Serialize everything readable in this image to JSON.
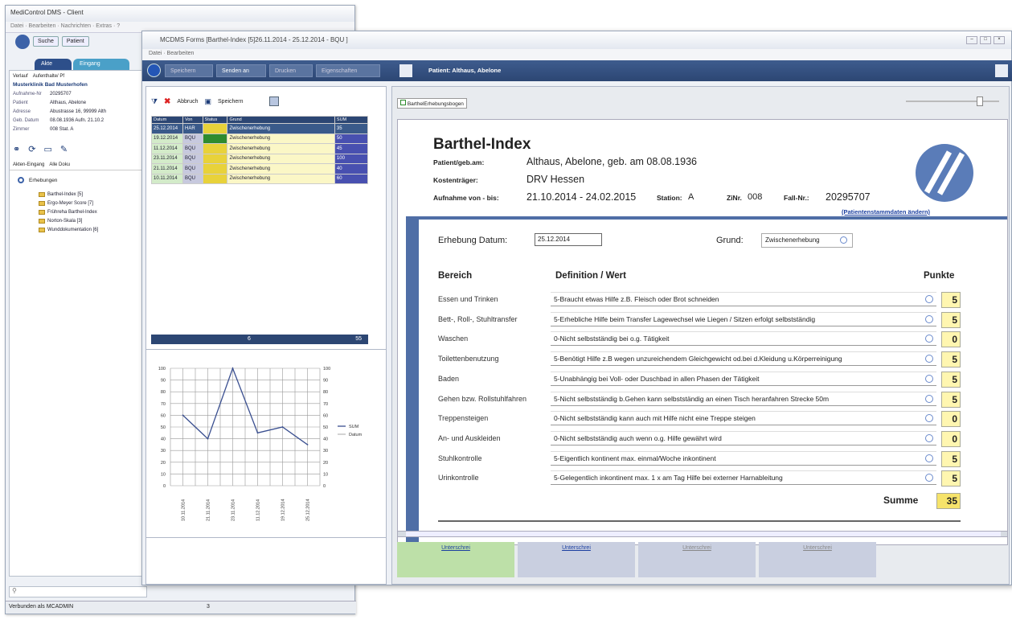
{
  "back_window": {
    "title": "MediControl DMS - Client",
    "menu": "Datei · Bearbeiten · Nachrichten · Extras · ?",
    "btn_search": "Suche",
    "btn_patient": "Patient",
    "tab_active": "Akte",
    "tab_inbox": "Eingang",
    "nav_history": "Verlauf",
    "nav_stays": "Aufenthalte/ Pf",
    "clinic": "Musterklinik Bad Musterhofen",
    "fields": [
      {
        "label": "Aufnahme-Nr",
        "value": "20295707"
      },
      {
        "label": "Patient",
        "value": "Althaus, Abelone"
      },
      {
        "label": "Adresse",
        "value": "Abustrasse 16, 99999 Alth"
      },
      {
        "label": "Geb. Datum",
        "value": "08.08.1936   Aufn. 21.10.2"
      },
      {
        "label": "Zimmer",
        "value": "008   Stat. A"
      }
    ],
    "doc_tab1": "Akten-Eingang",
    "doc_tab2": "Alle Doku",
    "tree_root": "Erhebungen",
    "tree_items": [
      "Barthel-Index [5]",
      "Ergo-Meyer Score [7]",
      "Frühreha Barthel-Index",
      "Norton-Skala [3]",
      "Wunddokumentation [6]"
    ],
    "status_left": "Verbunden als MCADMIN",
    "status_right": "3"
  },
  "front_window": {
    "title": "MCDMS Forms [Barthel-Index [5]26.11.2014 - 25.12.2014 - BQU ]",
    "menu": "Datei · Bearbeiten",
    "toolbar": {
      "save": "Speichern",
      "send": "Senden an",
      "print": "Drucken",
      "props": "Eigenschaften",
      "patient": "Patient: Althaus, Abelone"
    },
    "list_toolbar": {
      "abort": "Abbruch",
      "save": "Speichern"
    },
    "list_headers": [
      "Datum",
      "Von",
      "Status",
      "Grund",
      "SUM"
    ],
    "list_rows": [
      {
        "date": "25.12.2014",
        "by": "HAR",
        "reason": "Zwischenerhebung",
        "sum": "35"
      },
      {
        "date": "19.12.2014",
        "by": "BQU",
        "reason": "Zwischenerhebung",
        "sum": "50"
      },
      {
        "date": "11.12.2014",
        "by": "BQU",
        "reason": "Zwischenerhebung",
        "sum": "45"
      },
      {
        "date": "23.11.2014",
        "by": "BQU",
        "reason": "Zwischenerhebung",
        "sum": "100"
      },
      {
        "date": "21.11.2014",
        "by": "BQU",
        "reason": "Zwischenerhebung",
        "sum": "40"
      },
      {
        "date": "10.11.2014",
        "by": "BQU",
        "reason": "Zwischenerhebung",
        "sum": "60"
      }
    ],
    "list_footer": {
      "count": "6",
      "sum": "55"
    },
    "form_tab": "BarthelErhebungsbogen",
    "form": {
      "title": "Barthel-Index",
      "patient_label": "Patient/geb.am:",
      "patient_value": "Althaus, Abelone, geb. am 08.08.1936",
      "payer_label": "Kostenträger:",
      "payer_value": "DRV Hessen",
      "stay_label": "Aufnahme von - bis:",
      "stay_value": "21.10.2014 - 24.02.2015",
      "station_label": "Station:",
      "station_value": "A",
      "room_label": "ZiNr.",
      "room_value": "008",
      "case_label": "Fall-Nr.:",
      "case_value": "20295707",
      "edit_link": "(Patientenstammdaten ändern)",
      "date_label": "Erhebung Datum:",
      "date_value": "25.12.2014",
      "reason_label": "Grund:",
      "reason_value": "Zwischenerhebung",
      "col_area": "Bereich",
      "col_def": "Definition / Wert",
      "col_points": "Punkte",
      "sum_label": "Summe",
      "sum_value": "35",
      "items": [
        {
          "area": "Essen und Trinken",
          "def": "5-Braucht etwas Hilfe z.B. Fleisch oder Brot schneiden",
          "pts": "5"
        },
        {
          "area": "Bett-, Roll-, Stuhltransfer",
          "def": "5-Erhebliche Hilfe beim Transfer  Lagewechsel wie Liegen / Sitzen erfolgt selbstständig",
          "pts": "5"
        },
        {
          "area": "Waschen",
          "def": "0-Nicht selbstständig bei o.g. Tätigkeit",
          "pts": "0"
        },
        {
          "area": "Toilettenbenutzung",
          "def": "5-Benötigt Hilfe z.B wegen unzureichendem Gleichgewicht od.bei d.Kleidung u.Körperreinigung",
          "pts": "5"
        },
        {
          "area": "Baden",
          "def": "5-Unabhängig bei Voll- oder Duschbad in allen Phasen der Tätigkeit",
          "pts": "5"
        },
        {
          "area": "Gehen bzw. Rollstuhlfahren",
          "def": "5-Nicht selbstständig b.Gehen kann selbstständig an einen Tisch heranfahren Strecke 50m",
          "pts": "5"
        },
        {
          "area": "Treppensteigen",
          "def": "0-Nicht selbstständig kann auch  mit Hilfe nicht eine Treppe steigen",
          "pts": "0"
        },
        {
          "area": "An- und Auskleiden",
          "def": "0-Nicht selbstständig auch wenn o.g. Hilfe gewährt wird",
          "pts": "0"
        },
        {
          "area": "Stuhlkontrolle",
          "def": "5-Eigentlich kontinent max. einmal/Woche inkontinent",
          "pts": "5"
        },
        {
          "area": "Urinkontrolle",
          "def": "5-Gelegentlich inkontinent max. 1 x am Tag Hilfe bei externer Harnableitung",
          "pts": "5"
        }
      ]
    },
    "signature_tabs": [
      "Unterschrei",
      "Unterschrei",
      "Unterschrei",
      "Unterschrei"
    ],
    "colors": {
      "toolbar": "#2c4673",
      "selected_row": "#3a5a8a",
      "status_yellow": "#e8d23a",
      "status_green": "#2e8b2e",
      "points_bg": "#fff6b0"
    }
  },
  "chart_data": {
    "type": "line",
    "categories": [
      "10.11.2014",
      "21.11.2014",
      "23.11.2014",
      "11.12.2014",
      "19.12.2014",
      "25.12.2014"
    ],
    "series": [
      {
        "name": "SUM",
        "values": [
          60,
          40,
          100,
          45,
          50,
          35
        ]
      },
      {
        "name": "Datum",
        "values": []
      }
    ],
    "ylim": [
      0,
      100
    ],
    "yticks": [
      0,
      10,
      20,
      30,
      40,
      50,
      60,
      70,
      80,
      90,
      100
    ],
    "grid": true,
    "legend": "right"
  }
}
